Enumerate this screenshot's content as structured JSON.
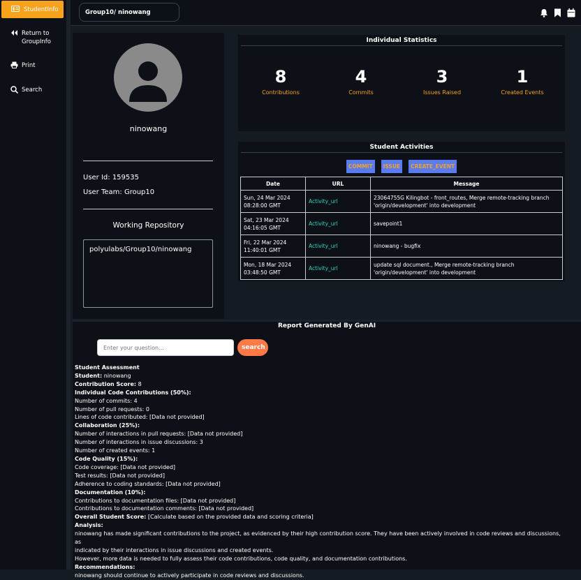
{
  "sidebar": {
    "active": {
      "label": "StudentInfo",
      "icon": "id-card-icon"
    },
    "items": [
      {
        "label_line1": "Return to",
        "label_line2": "GroupInfo",
        "icon": "double-chevron-left-icon"
      },
      {
        "label_line1": "Print",
        "label_line2": "",
        "icon": "printer-icon"
      },
      {
        "label_line1": "Search",
        "label_line2": "",
        "icon": "search-icon"
      }
    ]
  },
  "topbar": {
    "breadcrumb": "Group10/ ninowang",
    "icons": [
      "bell-icon",
      "bookmark-icon",
      "calendar-icon"
    ]
  },
  "profile": {
    "username": "ninowang",
    "user_id": "User Id: 159535",
    "user_team": "User Team: Group10",
    "working_repo_title": "Working Repository",
    "repo": "polyulabs/Group10/ninowang"
  },
  "stats": {
    "title": "Individual Statistics",
    "items": [
      {
        "value": "8",
        "label": "Contributions"
      },
      {
        "value": "4",
        "label": "Commits"
      },
      {
        "value": "3",
        "label": "Issues Raised"
      },
      {
        "value": "1",
        "label": "Created Events"
      }
    ]
  },
  "activities": {
    "title": "Student Activities",
    "filters": [
      "COMMIT",
      "ISSUE",
      "CREATE_EVENT"
    ],
    "columns": [
      "Date",
      "URL",
      "Message"
    ],
    "rows": [
      {
        "date1": "Sun, 24 Mar 2024",
        "date2": "08:28:00 GMT",
        "url": "Activity_url",
        "msg1": "23064755G Kilingbot - front_routes, Merge remote-tracking branch",
        "msg2": "'origin/development' into development"
      },
      {
        "date1": "Sat, 23 Mar 2024",
        "date2": "04:16:05 GMT",
        "url": "Activity_url",
        "msg1": "savepoint1",
        "msg2": ""
      },
      {
        "date1": "Fri, 22 Mar 2024",
        "date2": "11:40:01 GMT",
        "url": "Activity_url",
        "msg1": "ninowang - bugfix",
        "msg2": ""
      },
      {
        "date1": "Mon, 18 Mar 2024",
        "date2": "03:48:50 GMT",
        "url": "Activity_url",
        "msg1": "update sql document., Merge remote-tracking branch",
        "msg2": "'origin/development' into development"
      }
    ]
  },
  "report": {
    "title": "Report Generated By GenAI",
    "input_placeholder": "Enter your question...",
    "search_label": "search",
    "lines": [
      {
        "b": "Student Assessment",
        "t": ""
      },
      {
        "b": "Student:",
        "t": " ninowang"
      },
      {
        "b": "Contribution Score:",
        "t": " 8"
      },
      {
        "b": "Individual Code Contributions (50%):",
        "t": ""
      },
      {
        "b": "",
        "t": "Number of commits: 4"
      },
      {
        "b": "",
        "t": "Number of pull requests: 0"
      },
      {
        "b": "",
        "t": "Lines of code contributed: [Data not provided]"
      },
      {
        "b": "Collaboration (25%):",
        "t": ""
      },
      {
        "b": "",
        "t": "Number of interactions in pull requests: [Data not provided]"
      },
      {
        "b": "",
        "t": "Number of interactions in issue discussions: 3"
      },
      {
        "b": "",
        "t": "Number of created events: 1"
      },
      {
        "b": "Code Quality (15%):",
        "t": ""
      },
      {
        "b": "",
        "t": "Code coverage: [Data not provided]"
      },
      {
        "b": "",
        "t": "Test results: [Data not provided]"
      },
      {
        "b": "",
        "t": "Adherence to coding standards: [Data not provided]"
      },
      {
        "b": "Documentation (10%):",
        "t": ""
      },
      {
        "b": "",
        "t": "Contributions to documentation files: [Data not provided]"
      },
      {
        "b": "",
        "t": "Contributions to documentation comments: [Data not provided]"
      },
      {
        "b": "Overall Student Score:",
        "t": " [Calculate based on the provided data and scoring criteria]"
      },
      {
        "b": "Analysis:",
        "t": ""
      },
      {
        "b": "",
        "t": "ninowang has made significant contributions to the project, as evidenced by their high contribution score. They have been actively involved in code reviews and discussions, as"
      },
      {
        "b": "",
        "t": "indicated by their interactions in issue discussions and created events."
      },
      {
        "b": "",
        "t": "However, more data is needed to fully assess their code contributions, code quality, and documentation contributions."
      },
      {
        "b": "Recommendations:",
        "t": ""
      },
      {
        "b": "",
        "t": "ninowang should continue to actively participate in code reviews and discussions."
      }
    ]
  }
}
